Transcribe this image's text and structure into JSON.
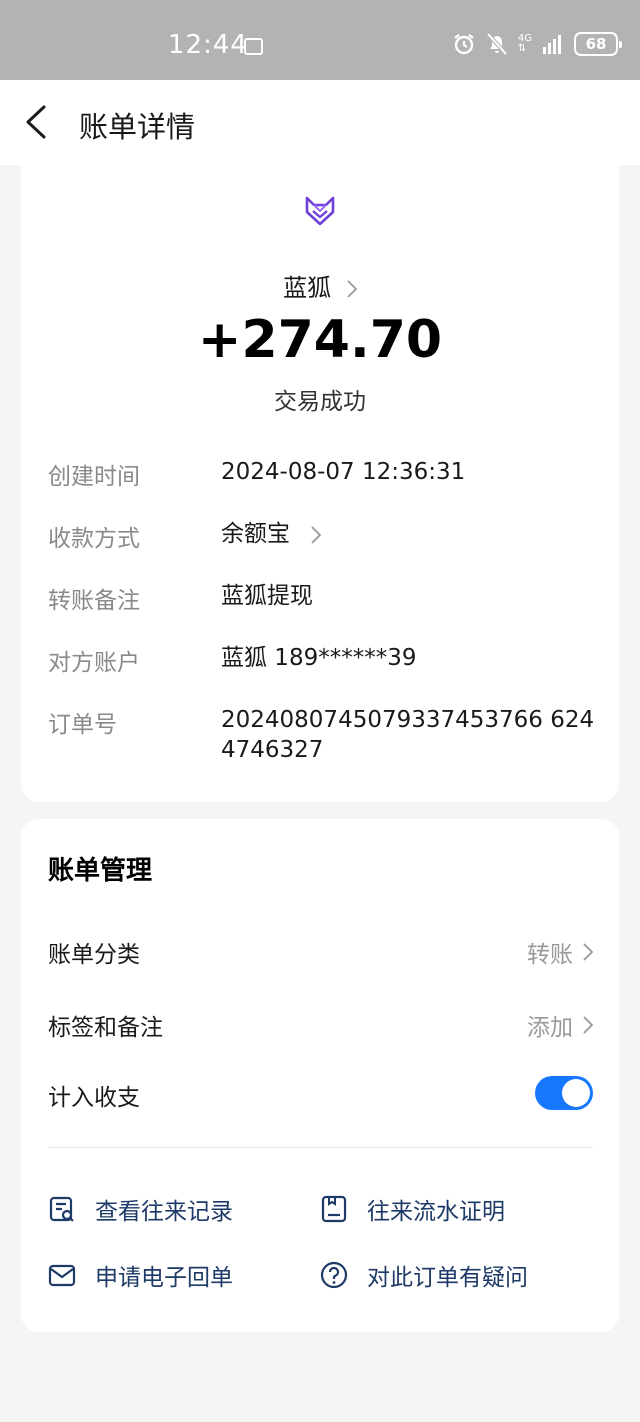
{
  "status_bar": {
    "time": "12:44",
    "network": "4G",
    "battery": "68",
    "icons": [
      "alarm-icon",
      "mute-icon",
      "signal-icon",
      "battery-icon"
    ]
  },
  "header": {
    "back_icon": "chevron-left-icon",
    "title": "账单详情"
  },
  "transaction": {
    "logo_icon": "fox-logo-icon",
    "payee": "蓝狐",
    "amount": "+274.70",
    "status": "交易成功",
    "details": [
      {
        "label": "创建时间",
        "value": "2024-08-07 12:36:31"
      },
      {
        "label": "收款方式",
        "value": "余额宝"
      },
      {
        "label": "转账备注",
        "value": "蓝狐提现"
      },
      {
        "label": "对方账户",
        "value": "蓝狐 189******39"
      },
      {
        "label": "订单号",
        "value": "2024080745079337453766 6244746327"
      }
    ]
  },
  "management": {
    "title": "账单管理",
    "rows": [
      {
        "label": "账单分类",
        "value": "转账"
      },
      {
        "label": "标签和备注",
        "value": "添加"
      },
      {
        "label": "计入收支",
        "toggle_on": true
      }
    ],
    "actions": [
      {
        "label": "查看往来记录",
        "icon": "record-search-icon"
      },
      {
        "label": "往来流水证明",
        "icon": "document-icon"
      },
      {
        "label": "申请电子回单",
        "icon": "mail-icon"
      },
      {
        "label": "对此订单有疑问",
        "icon": "question-icon"
      }
    ]
  },
  "colors": {
    "accent": "#1677ff",
    "action_text": "#1e3a66",
    "logo": "#6f3fd8"
  }
}
